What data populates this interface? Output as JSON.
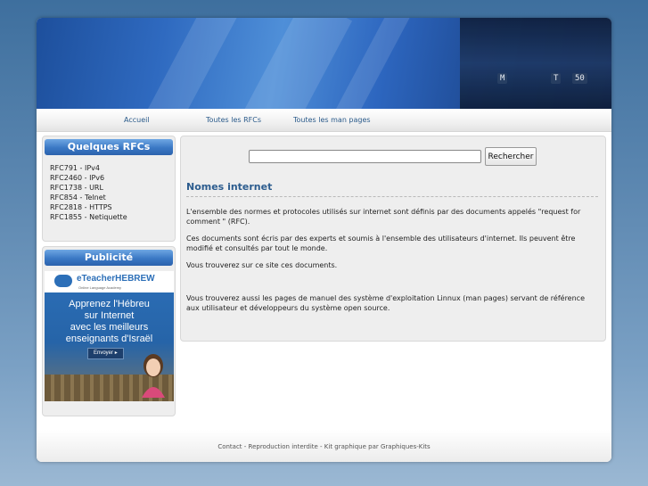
{
  "nav": {
    "items": [
      "Accueil",
      "Toutes les RFCs",
      "Toutes les man pages"
    ]
  },
  "sidebar": {
    "rfc_box": {
      "title": "Quelques RFCs",
      "items": [
        "RFC791 - IPv4",
        "RFC2460 - IPv6",
        "RFC1738 - URL",
        "RFC854 - Telnet",
        "RFC2818 - HTTPS",
        "RFC1855 - Netiquette"
      ]
    },
    "ad_box": {
      "title": "Publicité",
      "brand": "eTeacherHEBREW",
      "tagline": "Online Language Academy",
      "text_lines": [
        "Apprenez l'Hébreu",
        "sur Internet",
        "avec les meilleurs",
        "enseignants d'Israël"
      ],
      "button": "Envoyer"
    }
  },
  "search": {
    "input_value": "",
    "button_label": "Rechercher"
  },
  "main": {
    "title": "Nomes internet",
    "paragraphs": [
      "L'ensemble des normes et protocoles utilisés sur internet sont définis par des documents appelés \"request for comment \" (RFC).",
      "Ces documents sont écris par des experts et soumis à l'ensemble des utilisateurs d'internet. Ils peuvent être modifié et consultés par tout le monde.",
      "Vous trouverez sur ce site ces documents.",
      "Vous trouverez aussi les pages de manuel des système d'exploitation Linnux (man pages) servant de référence aux utilisateur et développeurs du système open source."
    ]
  },
  "footer": {
    "text": "Contact - Reproduction interdite - Kit graphique par Graphiques-Kits"
  },
  "banner": {
    "labels": [
      "M",
      "T",
      "50"
    ]
  },
  "colors": {
    "accent": "#2c5c8e",
    "header_blue": "#3a78c4"
  }
}
